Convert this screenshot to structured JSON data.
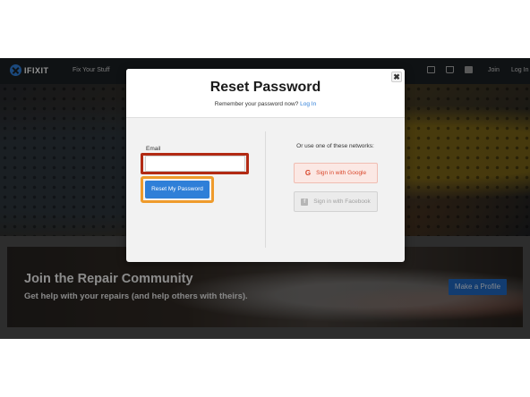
{
  "site": {
    "logo_text": "IFIXIT",
    "nav": {
      "fix_your_stuff": "Fix Your Stuff",
      "join": "Join",
      "log_in": "Log In"
    },
    "community": {
      "title": "Join the Repair Community",
      "subtitle": "Get help with your repairs (and help others with theirs).",
      "button": "Make a Profile"
    }
  },
  "modal": {
    "title": "Reset Password",
    "subtitle_prefix": "Remember your password now?",
    "subtitle_link": "Log In",
    "close_glyph": "✖",
    "email": {
      "label": "Email",
      "value": "",
      "placeholder": ""
    },
    "reset_button": "Reset My Password",
    "networks_label": "Or use one of these networks:",
    "google_button": "Sign in with Google",
    "google_icon": "google-g-icon",
    "facebook_button": "Sign in with Facebook",
    "facebook_icon": "facebook-f-icon"
  },
  "highlights": {
    "email_color": "#b22a14",
    "reset_color": "#ef9b2c"
  },
  "colors": {
    "accent": "#2f7fd8",
    "nav_bg": "#1b1f24"
  }
}
